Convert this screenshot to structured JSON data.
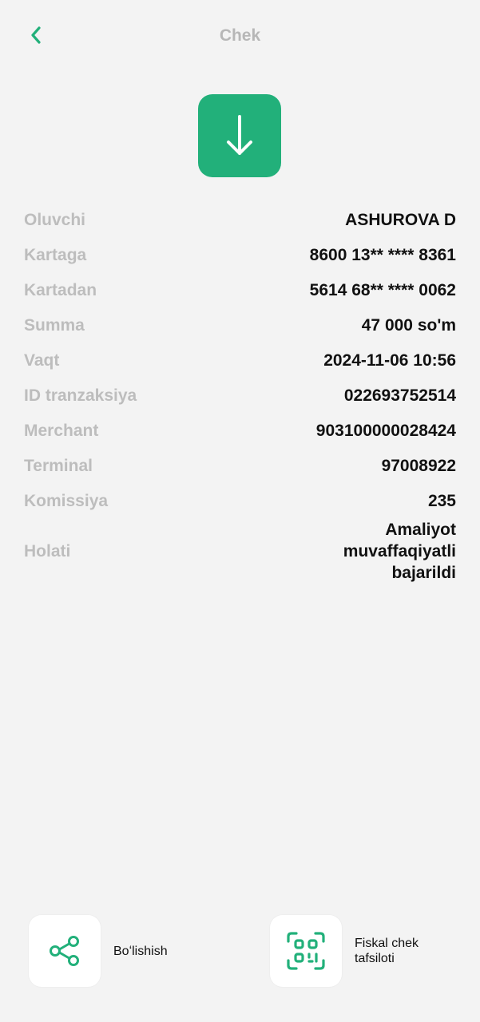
{
  "header": {
    "title": "Chek"
  },
  "colors": {
    "accent": "#22b07a",
    "label": "#bdbdbd",
    "value": "#111111",
    "background": "#f3f3f3"
  },
  "hero": {
    "icon": "arrow-down-icon"
  },
  "details": [
    {
      "label": "Oluvchi",
      "value": "ASHUROVA D"
    },
    {
      "label": "Kartaga",
      "value": "8600 13** **** 8361"
    },
    {
      "label": "Kartadan",
      "value": "5614 68** **** 0062"
    },
    {
      "label": "Summa",
      "value": "47 000 so'm"
    },
    {
      "label": "Vaqt",
      "value": "2024-11-06 10:56"
    },
    {
      "label": "ID tranzaksiya",
      "value": "022693752514"
    },
    {
      "label": "Merchant",
      "value": "903100000028424"
    },
    {
      "label": "Terminal",
      "value": "97008922"
    },
    {
      "label": "Komissiya",
      "value": "235"
    },
    {
      "label": "Holati",
      "value": "Amaliyot muvaffaqiyatli bajarildi"
    }
  ],
  "actions": {
    "share": {
      "label": "Boʻlishish",
      "icon": "share-icon"
    },
    "fiscal": {
      "label": "Fiskal chek tafsiloti",
      "icon": "qr-code-icon"
    }
  }
}
